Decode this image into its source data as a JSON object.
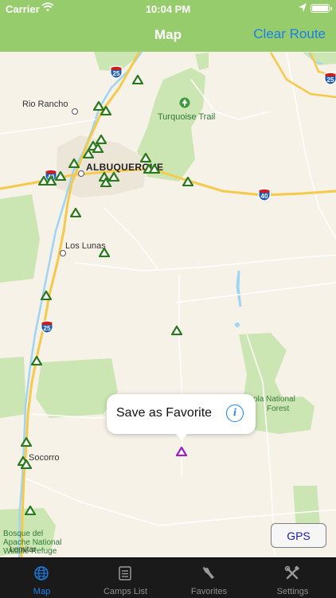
{
  "status_bar": {
    "carrier": "Carrier",
    "time": "10:04 PM",
    "battery_percent": 100
  },
  "nav": {
    "title": "Map",
    "clear_route": "Clear Route"
  },
  "map": {
    "labels": {
      "rio_rancho": "Rio Rancho",
      "albuquerque": "ALBUQUERQUE",
      "turquoise_trail": "Turquoise Trail",
      "los_lunas": "Los Lunas",
      "socorro": "Socorro",
      "bosque_line1": "Bosque del",
      "bosque_line2": "Apache National",
      "bosque_line3": "Wildlife Refuge",
      "forest_line1": "ola National",
      "forest_line2": "Forest",
      "lemitar": "Lemitar"
    },
    "shields": {
      "i25": "25",
      "i40": "40"
    },
    "colors": {
      "park": "#cce6b3",
      "road": "#f5c94a",
      "water": "#9fd4f2",
      "camp_marker": "#2a7a1d",
      "selected_marker": "#a21cc4"
    }
  },
  "callout": {
    "text": "Save as Favorite",
    "info_icon": "info-icon"
  },
  "gps_button": "GPS",
  "tabs": [
    {
      "label": "Map",
      "icon": "globe-icon",
      "active": true
    },
    {
      "label": "Camps List",
      "icon": "list-icon",
      "active": false
    },
    {
      "label": "Favorites",
      "icon": "favorites-icon",
      "active": false
    },
    {
      "label": "Settings",
      "icon": "tools-icon",
      "active": false
    }
  ]
}
